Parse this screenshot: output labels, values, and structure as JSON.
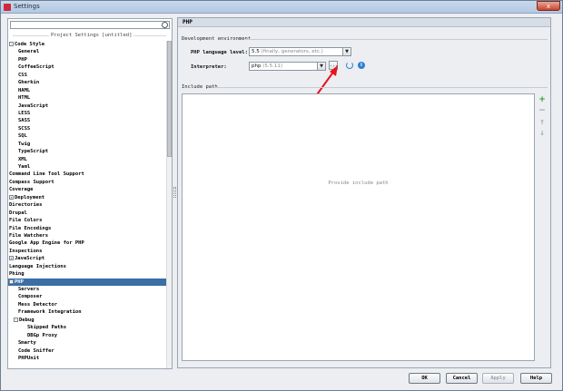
{
  "window": {
    "title": "Settings",
    "close_label": "x"
  },
  "left": {
    "search_placeholder": "",
    "section_label": "Project Settings [untitled]",
    "tree": [
      {
        "label": "Code Style",
        "indent": 0,
        "expander": "-"
      },
      {
        "label": "General",
        "indent": 2
      },
      {
        "label": "PHP",
        "indent": 2
      },
      {
        "label": "CoffeeScript",
        "indent": 2
      },
      {
        "label": "CSS",
        "indent": 2
      },
      {
        "label": "Gherkin",
        "indent": 2
      },
      {
        "label": "HAML",
        "indent": 2
      },
      {
        "label": "HTML",
        "indent": 2
      },
      {
        "label": "JavaScript",
        "indent": 2
      },
      {
        "label": "LESS",
        "indent": 2
      },
      {
        "label": "SASS",
        "indent": 2
      },
      {
        "label": "SCSS",
        "indent": 2
      },
      {
        "label": "SQL",
        "indent": 2
      },
      {
        "label": "Twig",
        "indent": 2
      },
      {
        "label": "TypeScript",
        "indent": 2
      },
      {
        "label": "XML",
        "indent": 2
      },
      {
        "label": "Yaml",
        "indent": 2
      },
      {
        "label": "Command Line Tool Support",
        "indent": 0
      },
      {
        "label": "Compass Support",
        "indent": 0
      },
      {
        "label": "Coverage",
        "indent": 0
      },
      {
        "label": "Deployment",
        "indent": 0,
        "expander": "+"
      },
      {
        "label": "Directories",
        "indent": 0
      },
      {
        "label": "Drupal",
        "indent": 0
      },
      {
        "label": "File Colors",
        "indent": 0
      },
      {
        "label": "File Encodings",
        "indent": 0
      },
      {
        "label": "File Watchers",
        "indent": 0
      },
      {
        "label": "Google App Engine for PHP",
        "indent": 0
      },
      {
        "label": "Inspections",
        "indent": 0
      },
      {
        "label": "JavaScript",
        "indent": 0,
        "expander": "+"
      },
      {
        "label": "Language Injections",
        "indent": 0
      },
      {
        "label": "Phing",
        "indent": 0
      },
      {
        "label": "PHP",
        "indent": 0,
        "expander": "-",
        "selected": true
      },
      {
        "label": "Servers",
        "indent": 2
      },
      {
        "label": "Composer",
        "indent": 2
      },
      {
        "label": "Mess Detector",
        "indent": 2
      },
      {
        "label": "Framework Integration",
        "indent": 2
      },
      {
        "label": "Debug",
        "indent": 1,
        "expander": "-"
      },
      {
        "label": "Skipped Paths",
        "indent": 4
      },
      {
        "label": "DBGp Proxy",
        "indent": 4
      },
      {
        "label": "Smarty",
        "indent": 2
      },
      {
        "label": "Code Sniffer",
        "indent": 2
      },
      {
        "label": "PHPUnit",
        "indent": 2
      }
    ]
  },
  "right": {
    "header": "PHP",
    "dev_env_label": "Development environment",
    "language_level_label": "PHP language level:",
    "language_level_value": "5.5",
    "language_level_hint": "(finally, generators, etc.)",
    "interpreter_label": "Interpreter:",
    "interpreter_value": "php",
    "interpreter_hint": "(5.5.11)",
    "more_button": "...",
    "include_path_label": "Include path",
    "include_placeholder": "Provide include path",
    "tools": {
      "add": "+",
      "remove": "−",
      "up": "↑",
      "down": "↓"
    }
  },
  "buttons": {
    "ok": "OK",
    "cancel": "Cancel",
    "apply": "Apply",
    "help": "Help"
  },
  "colors": {
    "selection": "#3a6ea5",
    "annotation_arrow": "#e8141b",
    "info_blue": "#2f7fd6"
  }
}
